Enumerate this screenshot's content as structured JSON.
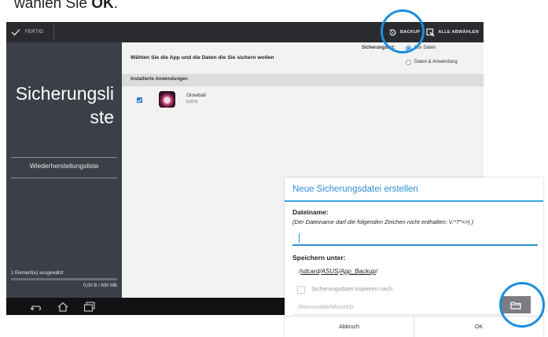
{
  "instruction": {
    "prefix": "wählen Sie ",
    "bold": "OK",
    "suffix": "."
  },
  "action_bar": {
    "done_icon": "check-icon",
    "done_label": "FERTIG",
    "backup_icon": "backup-restore-icon",
    "backup_label": "BACKUP",
    "select_all_icon": "select-all-icon",
    "select_all_label": "ALLE ABWÄHLEN"
  },
  "sidebar": {
    "title_line1": "Sicherungsli",
    "title_line2": "ste",
    "restore_list_link": "Wiederherstellungsliste",
    "selection_status": "1 Element(e) ausgewählt",
    "storage_usage": "0,00 B / 600 MB"
  },
  "main": {
    "prompt": "Wählen Sie die App und die Daten die Sie sichern wollen",
    "backup_type_label": "Sicherungsart:",
    "backup_type_options": [
      "Nur Daten",
      "Daten & Anwendung"
    ],
    "backup_type_selected": "Nur Daten",
    "installed_apps_header": "Installierte Anwendungen",
    "apps": [
      {
        "name": "Glowball",
        "size": "0,00 B",
        "checked": true
      }
    ]
  },
  "navbar": {
    "icons": [
      "back-icon",
      "home-icon",
      "recent-apps-icon"
    ]
  },
  "dialog": {
    "title": "Neue Sicherungsdatei erstellen",
    "filename_label": "Dateiname:",
    "filename_note": "(Der Dateiname darf die folgenden Zeichen nicht enthalten: \\/:*?\"<>| )",
    "filename_value": "",
    "save_under_label": "Speichern unter:",
    "save_path_parts": [
      "sdcard",
      "ASUS",
      "App_Backup"
    ],
    "copy_checkbox_label": "Sicherungsdatei kopieren nach:",
    "copy_checked": false,
    "copy_path": "/Removable/MicroSD",
    "folder_icon": "folder-icon",
    "cancel_label": "Abbruch",
    "ok_label": "OK"
  },
  "colors": {
    "accent": "#2f8fd1",
    "highlight_circle": "#1a8fdc",
    "sidebar_bg": "#3c3f47",
    "action_bar_bg": "#2a2b2e"
  }
}
